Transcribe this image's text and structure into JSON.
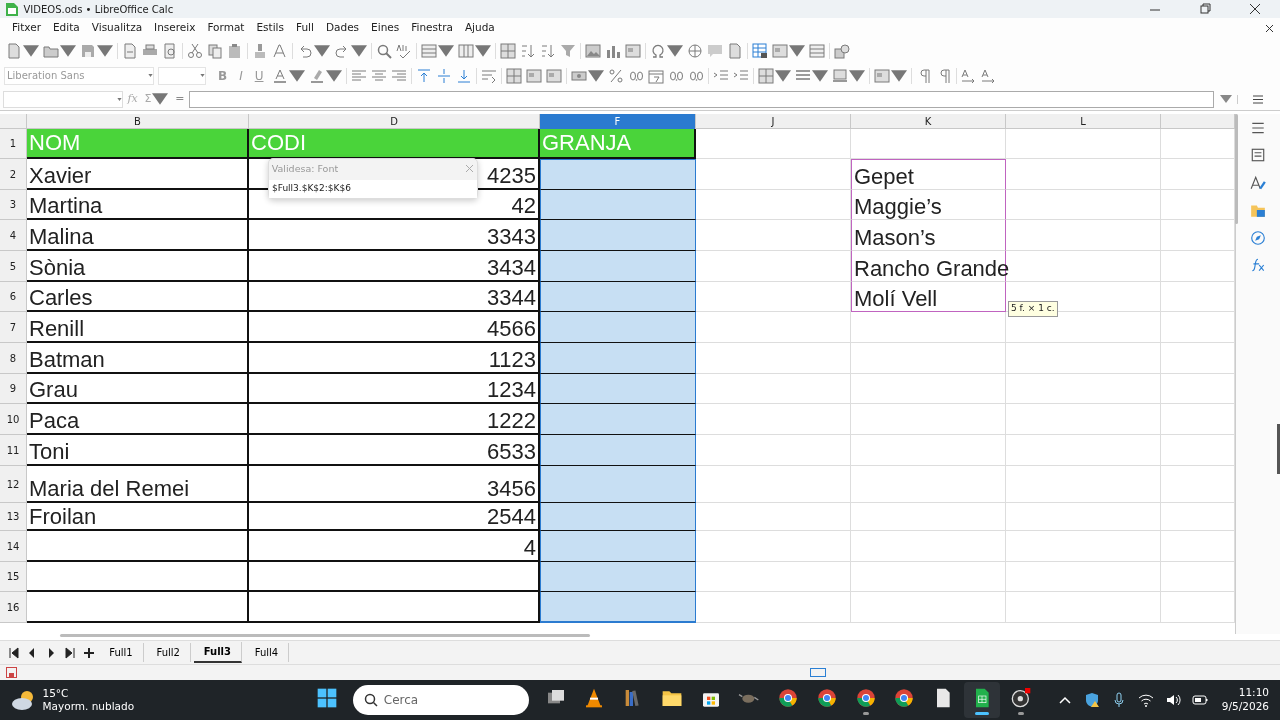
{
  "window": {
    "title": "VIDEOS.ods • LibreOffice Calc"
  },
  "menu": [
    "Fitxer",
    "Edita",
    "Visualitza",
    "Insereix",
    "Format",
    "Estils",
    "Full",
    "Dades",
    "Eines",
    "Finestra",
    "Ajuda"
  ],
  "standard_toolbar": [
    {
      "kind": "document",
      "dropdown": true
    },
    {
      "kind": "folder",
      "dropdown": true
    },
    {
      "kind": "save",
      "dropdown": true
    },
    {
      "kind": "pdf",
      "dropdown": false
    },
    {
      "kind": "printer",
      "dropdown": false
    },
    {
      "kind": "preview",
      "dropdown": false
    },
    {
      "kind": "scissors",
      "dropdown": false
    },
    {
      "kind": "copy",
      "dropdown": false
    },
    {
      "kind": "clipboard",
      "dropdown": false
    },
    {
      "kind": "brush",
      "dropdown": false
    },
    {
      "kind": "eraser",
      "dropdown": false
    },
    {
      "kind": "undo",
      "dropdown": true
    },
    {
      "kind": "redo",
      "dropdown": true
    },
    {
      "kind": "search",
      "dropdown": false
    },
    {
      "kind": "spell",
      "dropdown": false
    },
    {
      "kind": "rows",
      "dropdown": true
    },
    {
      "kind": "columns",
      "dropdown": true
    },
    {
      "kind": "grid",
      "dropdown": false
    },
    {
      "kind": "sort",
      "dropdown": false
    },
    {
      "kind": "sort",
      "dropdown": false
    },
    {
      "kind": "funnel",
      "dropdown": false
    },
    {
      "kind": "image",
      "dropdown": false
    },
    {
      "kind": "chart",
      "dropdown": false
    },
    {
      "kind": "table",
      "dropdown": false
    },
    {
      "kind": "omega",
      "dropdown": true
    },
    {
      "kind": "globe",
      "dropdown": false
    },
    {
      "kind": "comment",
      "dropdown": false
    },
    {
      "kind": "document",
      "dropdown": false
    },
    {
      "kind": "sheet",
      "dropdown": false
    },
    {
      "kind": "table",
      "dropdown": true
    },
    {
      "kind": "rows",
      "dropdown": false
    },
    {
      "kind": "shapes",
      "dropdown": false
    }
  ],
  "format_toolbar": {
    "font_name": "Liberation Sans",
    "bold": "B",
    "italic": "I",
    "underline": "U",
    "buttons": [
      {
        "kind": "font-color",
        "dropdown": true
      },
      {
        "kind": "highlight",
        "dropdown": true
      },
      {
        "kind": "align-left",
        "dropdown": false
      },
      {
        "kind": "align-center",
        "dropdown": false
      },
      {
        "kind": "align-right",
        "dropdown": false
      },
      {
        "kind": "valign-top",
        "dropdown": false
      },
      {
        "kind": "valign-center",
        "dropdown": false
      },
      {
        "kind": "valign-bottom",
        "dropdown": false
      },
      {
        "kind": "wrap",
        "dropdown": false
      },
      {
        "kind": "grid",
        "dropdown": false
      },
      {
        "kind": "table",
        "dropdown": false
      },
      {
        "kind": "table",
        "dropdown": false
      },
      {
        "kind": "money",
        "dropdown": true
      },
      {
        "kind": "percent",
        "dropdown": false
      },
      {
        "kind": "decimal",
        "dropdown": false
      },
      {
        "kind": "calendar",
        "dropdown": false
      },
      {
        "kind": "decimal",
        "dropdown": false
      },
      {
        "kind": "decimal",
        "dropdown": false
      },
      {
        "kind": "indent",
        "dropdown": false
      },
      {
        "kind": "indent",
        "dropdown": false
      },
      {
        "kind": "grid",
        "dropdown": true
      },
      {
        "kind": "lines",
        "dropdown": true
      },
      {
        "kind": "monitor",
        "dropdown": true
      },
      {
        "kind": "table",
        "dropdown": true
      },
      {
        "kind": "pilcrow",
        "dropdown": false
      },
      {
        "kind": "pilcrow",
        "dropdown": false
      },
      {
        "kind": "text-direction",
        "dropdown": false
      },
      {
        "kind": "text-direction",
        "dropdown": false
      }
    ]
  },
  "formula_bar": {
    "function_symbol": "fx",
    "sum_symbol": "Σ",
    "equals_symbol": "="
  },
  "columns": [
    {
      "label": "B",
      "selected": false
    },
    {
      "label": "D",
      "selected": false
    },
    {
      "label": "F",
      "selected": true
    },
    {
      "label": "J",
      "selected": false
    },
    {
      "label": "K",
      "selected": false
    },
    {
      "label": "L",
      "selected": false
    }
  ],
  "rows": [
    {
      "number": "1",
      "kind": "header",
      "column_b": "NOM",
      "column_d": "CODI",
      "column_f": "GRANJA",
      "selected": false,
      "referenced": false
    },
    {
      "number": "2",
      "kind": "data",
      "column_b": "Xavier",
      "column_d": "4235",
      "column_k": "Gepet",
      "selected": true,
      "referenced": true
    },
    {
      "number": "3",
      "kind": "data",
      "column_b": "Martina",
      "column_d": "42",
      "column_k": "Maggie’s",
      "selected": true,
      "referenced": true
    },
    {
      "number": "4",
      "kind": "data",
      "column_b": "Malina",
      "column_d": "3343",
      "column_k": "Mason’s",
      "selected": true,
      "referenced": true
    },
    {
      "number": "5",
      "kind": "data",
      "column_b": "Sònia",
      "column_d": "3434",
      "column_k": "Rancho Grande",
      "selected": true,
      "referenced": true
    },
    {
      "number": "6",
      "kind": "data",
      "column_b": "Carles",
      "column_d": "3344",
      "column_k": "Molí Vell",
      "selected": true,
      "referenced": true
    },
    {
      "number": "7",
      "kind": "data",
      "column_b": "Renill",
      "column_d": "4566",
      "selected": true,
      "referenced": false
    },
    {
      "number": "8",
      "kind": "data",
      "column_b": "Batman",
      "column_d": "1123",
      "selected": true,
      "referenced": false
    },
    {
      "number": "9",
      "kind": "data",
      "column_b": "Grau",
      "column_d": "1234",
      "selected": true,
      "referenced": false
    },
    {
      "number": "10",
      "kind": "data",
      "column_b": "Paca",
      "column_d": "1222",
      "selected": true,
      "referenced": false
    },
    {
      "number": "11",
      "kind": "data",
      "column_b": "Toni",
      "column_d": "6533",
      "selected": true,
      "referenced": false
    },
    {
      "number": "12",
      "kind": "data",
      "column_b": "Maria del Remei",
      "column_d": "3456",
      "selected": true,
      "referenced": false
    },
    {
      "number": "13",
      "kind": "data",
      "column_b": "Froilan",
      "column_d": "2544",
      "selected": true,
      "referenced": false
    },
    {
      "number": "14",
      "kind": "data",
      "column_d": "4",
      "selected": true,
      "referenced": false
    },
    {
      "number": "15",
      "kind": "data",
      "selected": true,
      "referenced": false
    },
    {
      "number": "16",
      "kind": "data",
      "selected": true,
      "referenced": false
    }
  ],
  "validity_popup": {
    "title": "Validesa: Font",
    "value": "$Full3.$K$2:$K$6"
  },
  "range_tooltip": "5 f. × 1 c.",
  "sheet_tabs": [
    {
      "label": "Full1",
      "selected": false
    },
    {
      "label": "Full2",
      "selected": false
    },
    {
      "label": "Full3",
      "selected": true
    },
    {
      "label": "Full4",
      "selected": false
    }
  ],
  "sidebar": [
    {
      "kind": "menu"
    },
    {
      "kind": "properties"
    },
    {
      "kind": "styles"
    },
    {
      "kind": "gallery"
    },
    {
      "kind": "navigator"
    },
    {
      "kind": "functions"
    }
  ],
  "taskbar": {
    "weather": {
      "temperature": "15°C",
      "condition": "Mayorm. nublado"
    },
    "search_placeholder": "Cerca",
    "apps": [
      {
        "kind": "windows",
        "running": false,
        "active": false
      },
      {
        "kind": "task-view",
        "running": false,
        "active": false
      },
      {
        "kind": "cone",
        "running": false,
        "active": false
      },
      {
        "kind": "books",
        "running": false,
        "active": false
      },
      {
        "kind": "folder",
        "running": false,
        "active": false
      },
      {
        "kind": "store",
        "running": false,
        "active": false
      },
      {
        "kind": "gimp",
        "running": false,
        "active": false
      },
      {
        "kind": "chrome",
        "running": false,
        "active": false
      },
      {
        "kind": "chrome",
        "running": false,
        "active": false
      },
      {
        "kind": "chrome",
        "running": true,
        "active": false
      },
      {
        "kind": "chrome",
        "running": false,
        "active": false
      },
      {
        "kind": "document",
        "running": false,
        "active": false
      },
      {
        "kind": "calc",
        "running": true,
        "active": true
      },
      {
        "kind": "obs",
        "running": true,
        "active": false
      }
    ],
    "time": "11:10",
    "date": "9/5/2026"
  }
}
